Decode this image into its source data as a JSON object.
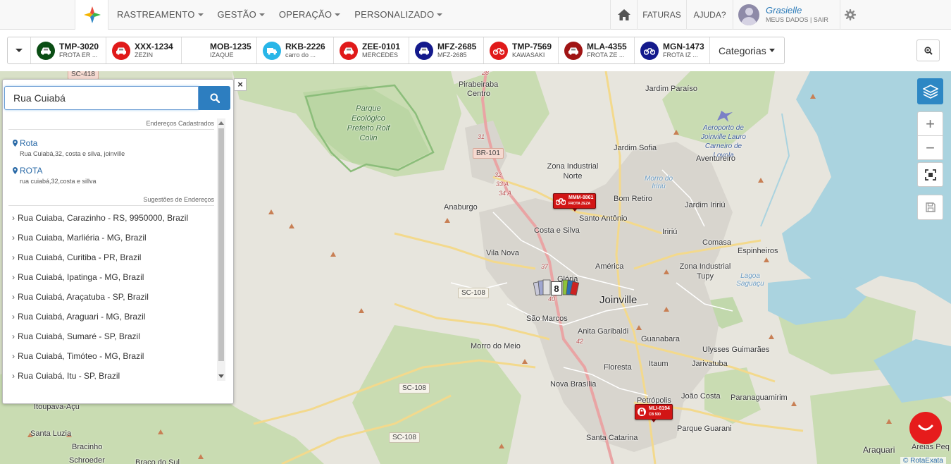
{
  "nav": {
    "menu": [
      "RASTREAMENTO",
      "GESTÃO",
      "OPERAÇÃO",
      "PERSONALIZADO"
    ],
    "faturas": "FATURAS",
    "ajuda": "AJUDA?",
    "user_name": "Grasielle",
    "user_links": "MEUS DADOS | SAIR"
  },
  "vehicles": [
    {
      "plate": "TMP-3020",
      "name": "FROTA ER ...",
      "icon": "car-icon",
      "color": "#0a4d14"
    },
    {
      "plate": "XXX-1234",
      "name": "ZEZIN",
      "icon": "car-icon",
      "color": "#e01a1a"
    },
    {
      "plate": "MOB-1235",
      "name": "IZAQUE",
      "icon": "",
      "color": ""
    },
    {
      "plate": "RKB-2226",
      "name": "carro do ...",
      "icon": "truck-icon",
      "color": "#29b6e8"
    },
    {
      "plate": "ZEE-0101",
      "name": "MERCEDES",
      "icon": "car-icon",
      "color": "#e01a1a"
    },
    {
      "plate": "MFZ-2685",
      "name": "MFZ-2685",
      "icon": "car-icon",
      "color": "#141a8c"
    },
    {
      "plate": "TMP-7569",
      "name": "KAWASAKI",
      "icon": "motorcycle-icon",
      "color": "#e01a1a"
    },
    {
      "plate": "MLA-4355",
      "name": "FROTA ZE ...",
      "icon": "car-icon",
      "color": "#a01414"
    },
    {
      "plate": "MGN-1473",
      "name": "FROTA IZ ...",
      "icon": "motorcycle-icon",
      "color": "#141a8c"
    }
  ],
  "categories_label": "Categorias",
  "search": {
    "value": "Rua Cuiabá",
    "saved_title": "Endereços Cadastrados",
    "saved": [
      {
        "title": "Rota",
        "address": "Rua Cuiabá,32, costa e silva, joinville"
      },
      {
        "title": "ROTA",
        "address": "rua cuiabá,32,costa e sillva"
      }
    ],
    "suggestions_title": "Sugestões de Endereços",
    "suggestions": [
      "Rua Cuiaba, Carazinho - RS, 9950000, Brazil",
      "Rua Cuiaba, Marliéria - MG, Brazil",
      "Rua Cuiabá, Curitiba - PR, Brazil",
      "Rua Cuiabá, Ipatinga - MG, Brazil",
      "Rua Cuiabá, Araçatuba - SP, Brazil",
      "Rua Cuiabá, Araguari - MG, Brazil",
      "Rua Cuiabá, Sumaré - SP, Brazil",
      "Rua Cuiabá, Timóteo - MG, Brazil",
      "Rua Cuiabá, Itu - SP, Brazil"
    ],
    "close": "×"
  },
  "map": {
    "labels": {
      "pirabeiraba": "Pirabeiraba",
      "centro": "Centro",
      "jardim_paraiso": "Jardim Paraíso",
      "aeroporto": "Aeroporto de Joinville Lauro Carneiro de Loyola",
      "jardim_sofia": "Jardim Sofia",
      "zona_norte": "Zona Industrial Norte",
      "aventureiro": "Aventureiro",
      "morro_iririu": "Morro do Iririú",
      "bom_retiro": "Bom Retiro",
      "jardim_iririu": "Jardim Iririú",
      "anaburgo": "Anaburgo",
      "costa_e_silva": "Costa e Silva",
      "santo_antonio": "Santo Antônio",
      "iririu": "Iririú",
      "comasa": "Comasa",
      "vila_nova": "Vila Nova",
      "espinheiros": "Espinheiros",
      "america": "América",
      "zona_tupy": "Zona Industrial Tupy",
      "lagoa_saguacu": "Lagoa Saguaçu",
      "gloria": "Glória",
      "joinville": "Joinville",
      "sao_marcos": "São Marcos",
      "anita_garibaldi": "Anita Garibaldi",
      "guanabara": "Guanabara",
      "morro_do_meio": "Morro do Meio",
      "ulysses": "Ulysses Guimarães",
      "floresta": "Floresta",
      "itaum": "Itaum",
      "jarivatuba": "Jarivatuba",
      "nova_brasilia": "Nova Brasília",
      "petropolis": "Petrópolis",
      "joao_costa": "João Costa",
      "paranaguamirim": "Paranaguamirim",
      "parque_guarani": "Parque Guarani",
      "itoupava": "Itoupava-Açu",
      "santa_luzia": "Santa Luzia",
      "bracinho": "Bracinho",
      "schroeder": "Schroeder",
      "braco_do_sul": "Braço do Sul",
      "santa_catarina": "Santa Catarina",
      "araquari": "Araquari",
      "areias": "Areias Peq",
      "parque": "Parque Ecológico Prefeito Rolf Colin"
    },
    "roads": [
      "SC-418",
      "BR-101",
      "SC-108",
      "SC-108",
      "SC-108"
    ],
    "road_numbers": [
      "28",
      "31",
      "32",
      "33 A",
      "34 A",
      "37",
      "40",
      "42"
    ],
    "markers": [
      {
        "plate": "MMM-8861",
        "name": "FROTA ZEZA"
      },
      {
        "plate": "MLI-8194",
        "name": "CB 500"
      }
    ],
    "cluster_count": "8",
    "credit": "© RotaExata"
  }
}
